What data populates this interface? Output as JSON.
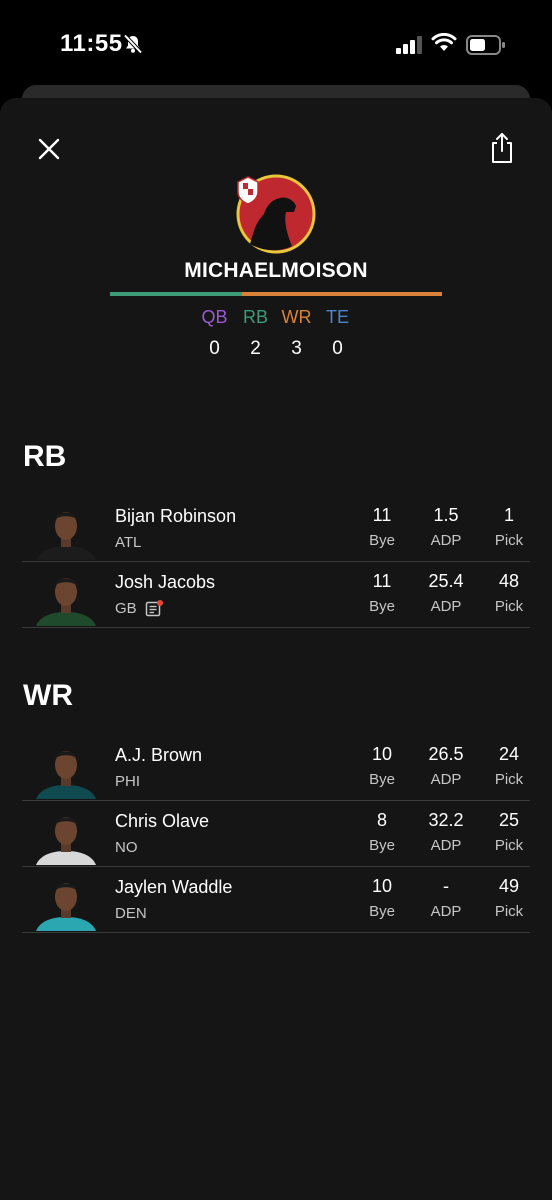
{
  "status": {
    "time": "11:55"
  },
  "team": {
    "name": "MICHAELMOISON",
    "positions": [
      {
        "label": "QB",
        "count": "0",
        "color": "#9b59d0"
      },
      {
        "label": "RB",
        "count": "2",
        "color": "#3d9b78"
      },
      {
        "label": "WR",
        "count": "3",
        "color": "#d9823a"
      },
      {
        "label": "TE",
        "count": "0",
        "color": "#4a86c9"
      }
    ]
  },
  "sections": {
    "rb": {
      "title": "RB",
      "players": [
        {
          "name": "Bijan Robinson",
          "team": "ATL",
          "bye": "11",
          "adp": "1.5",
          "pick": "1",
          "jersey": "#1c1c1c"
        },
        {
          "name": "Josh Jacobs",
          "team": "GB",
          "bye": "11",
          "adp": "25.4",
          "pick": "48",
          "jersey": "#1f4a2c",
          "has_note": true
        }
      ]
    },
    "wr": {
      "title": "WR",
      "players": [
        {
          "name": "A.J. Brown",
          "team": "PHI",
          "bye": "10",
          "adp": "26.5",
          "pick": "24",
          "jersey": "#0e4a4f"
        },
        {
          "name": "Chris Olave",
          "team": "NO",
          "bye": "8",
          "adp": "32.2",
          "pick": "25",
          "jersey": "#d8d8d8"
        },
        {
          "name": "Jaylen Waddle",
          "team": "DEN",
          "bye": "10",
          "adp": "-",
          "pick": "49",
          "jersey": "#2aa7b0"
        }
      ]
    }
  },
  "labels": {
    "bye": "Bye",
    "adp": "ADP",
    "pick": "Pick"
  },
  "icons": {
    "close": "close-icon",
    "share": "share-icon",
    "bell": "bell-slash-icon",
    "signal": "signal-icon",
    "wifi": "wifi-icon",
    "battery": "battery-icon",
    "note": "news-note-icon"
  }
}
